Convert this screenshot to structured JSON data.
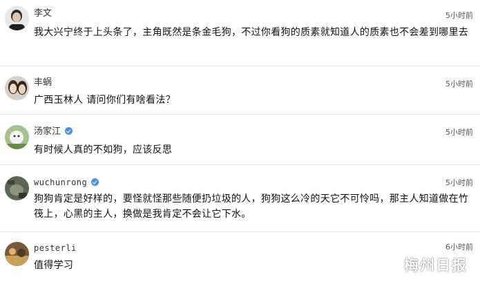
{
  "comments": [
    {
      "username": "李文",
      "time": "5小时前",
      "text": "我大兴宁终于上头条了，主角既然是条金毛狗，不过你看狗的质素就知道人的质素也不会差到哪里去",
      "avatar_color": "#9a9a9a"
    },
    {
      "username": "丰蜗",
      "time": "5小时前",
      "text": "广西玉林人 请问你们有啥看法？",
      "avatar_color": "#b59f8c"
    },
    {
      "username": "汤家江",
      "time": "5小时前",
      "text": "有时候人真的不如狗，应该反思",
      "verified": true,
      "avatar_color": "#7f9a6a"
    },
    {
      "username": "wuchunrong",
      "time": "5小时前",
      "text": "狗狗肯定是好样的，要怪就怪那些随便扔垃圾的人，狗狗这么冷的天它不可怜吗，那主人知道做在竹筏上，心黑的主人，换做是我肯定不会让它下水。",
      "verified": true,
      "avatar_color": "#6f7a68"
    },
    {
      "username": "pesterli",
      "time": "6小时前",
      "text": "值得学习",
      "avatar_color": "#8a6a44"
    }
  ],
  "watermark": {
    "text": "梅州日报",
    "icon": "wechat-icon"
  }
}
